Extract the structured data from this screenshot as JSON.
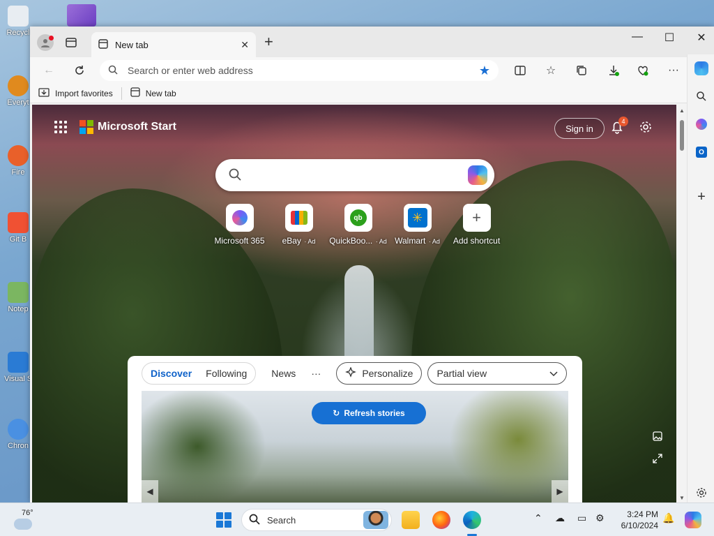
{
  "desktop": {
    "icons": [
      {
        "label": "Recycl",
        "color": "#e8edf2"
      },
      {
        "label": "Everyt",
        "color": "#e08a1e"
      },
      {
        "label": "Fire",
        "color": "#e9602a"
      },
      {
        "label": "Git B",
        "color": "#f05133"
      },
      {
        "label": "Notep",
        "color": "#7bb661"
      },
      {
        "label": "Visual S Co",
        "color": "#2a7bd4"
      },
      {
        "label": "Chron",
        "color": "#4a90e2"
      }
    ]
  },
  "browser": {
    "tab_title": "New tab",
    "address_placeholder": "Search or enter web address",
    "favorites": {
      "import_label": "Import favorites",
      "newtab_label": "New tab"
    }
  },
  "newtab": {
    "brand": "Microsoft Start",
    "signin_label": "Sign in",
    "notification_count": "4",
    "shortcuts": [
      {
        "label": "Microsoft 365",
        "ad": "",
        "color": "#7a5af5"
      },
      {
        "label": "eBay",
        "ad": "Ad",
        "color": "#e53238"
      },
      {
        "label": "QuickBoo...",
        "ad": "Ad",
        "color": "#2ca01c"
      },
      {
        "label": "Walmart",
        "ad": "Ad",
        "color": "#0071ce"
      },
      {
        "label": "Add shortcut",
        "ad": "",
        "color": "#555555"
      }
    ],
    "feed": {
      "tabs": [
        "Discover",
        "Following"
      ],
      "active_tab": "Discover",
      "news_label": "News",
      "more_label": "···",
      "personalize_label": "Personalize",
      "view_label": "Partial view",
      "refresh_label": "Refresh stories"
    }
  },
  "taskbar": {
    "temperature": "76°",
    "search_label": "Search",
    "time": "3:24 PM",
    "date": "6/10/2024"
  },
  "colors": {
    "accent": "#1770d3",
    "active_tab_text": "#0f62c9",
    "badge": "#e8572f"
  }
}
